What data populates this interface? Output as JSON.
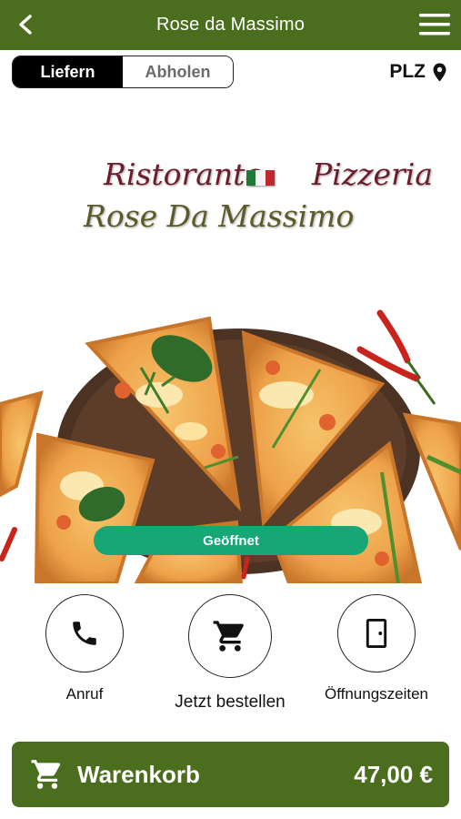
{
  "header": {
    "title": "Rose da Massimo",
    "back_icon": "chevron-left-icon",
    "menu_icon": "hamburger-menu-icon"
  },
  "delivery_toggle": {
    "options": [
      "Liefern",
      "Abholen"
    ],
    "selected": "Liefern"
  },
  "postcode": {
    "label": "PLZ",
    "icon": "location-pin-icon"
  },
  "hero": {
    "brand_line1_left": "Ristorante",
    "brand_line1_right": "Pizzeria",
    "brand_line2": "Rose Da Massimo",
    "status": "Geöffnet"
  },
  "actions": [
    {
      "label": "Anruf",
      "icon": "phone-icon"
    },
    {
      "label": "Jetzt bestellen",
      "icon": "shopping-cart-icon"
    },
    {
      "label": "Öffnungszeiten",
      "icon": "door-icon"
    }
  ],
  "cart": {
    "label": "Warenkorb",
    "total": "47,00 €",
    "icon": "shopping-cart-icon"
  },
  "colors": {
    "brand_green": "#4a6e1e",
    "status_green": "#17a676",
    "toggle_active": "#000000"
  }
}
